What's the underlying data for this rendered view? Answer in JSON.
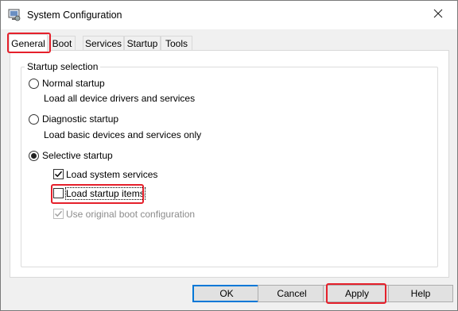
{
  "window": {
    "title": "System Configuration",
    "icon": "msconfig-icon",
    "close_glyph": "✕"
  },
  "tabs": [
    {
      "label": "General",
      "active": true,
      "highlighted": true
    },
    {
      "label": "Boot"
    },
    {
      "label": "Services"
    },
    {
      "label": "Startup"
    },
    {
      "label": "Tools"
    }
  ],
  "startup_selection": {
    "legend": "Startup selection",
    "normal": {
      "label": "Normal startup",
      "description": "Load all device drivers and services",
      "selected": false
    },
    "diagnostic": {
      "label": "Diagnostic startup",
      "description": "Load basic devices and services only",
      "selected": false
    },
    "selective": {
      "label": "Selective startup",
      "selected": true,
      "options": [
        {
          "label": "Load system services",
          "checked": true,
          "enabled": true
        },
        {
          "label": "Load startup items",
          "checked": false,
          "enabled": true,
          "highlighted": true
        },
        {
          "label": "Use original boot configuration",
          "checked": true,
          "enabled": false
        }
      ]
    }
  },
  "buttons": {
    "ok": "OK",
    "cancel": "Cancel",
    "apply": "Apply",
    "help": "Help"
  },
  "colors": {
    "highlight": "#e5202b",
    "check_mark": "#000000",
    "disabled_text": "#8c8c8c"
  }
}
